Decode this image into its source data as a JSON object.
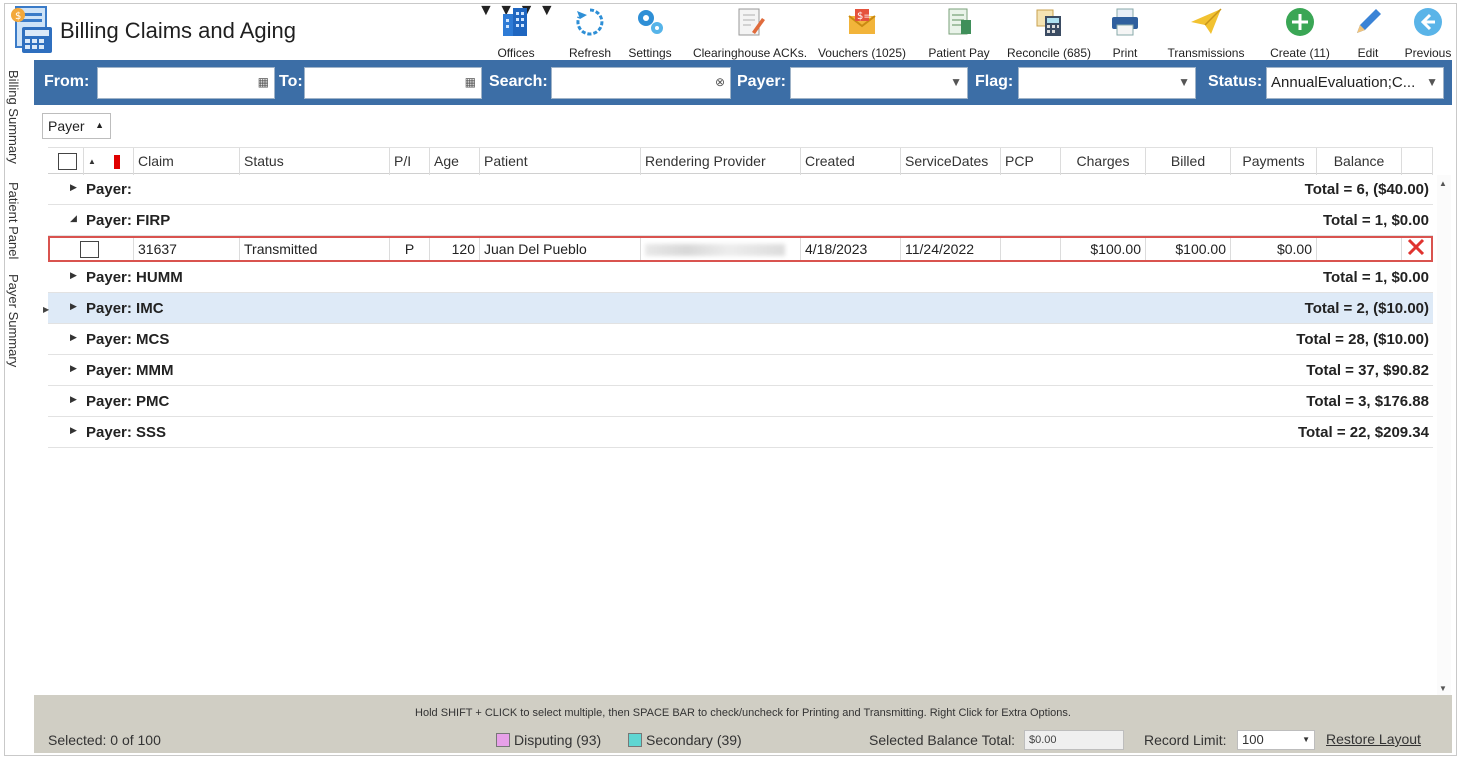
{
  "app": {
    "title": "Billing Claims and Aging"
  },
  "toolbar": {
    "offices": "Offices",
    "refresh": "Refresh",
    "settings": "Settings",
    "clearinghouse": "Clearinghouse ACKs.",
    "vouchers": "Vouchers (1025)",
    "patient_pay": "Patient Pay",
    "reconcile": "Reconcile (685)",
    "print": "Print",
    "transmissions": "Transmissions",
    "create": "Create (11)",
    "edit": "Edit",
    "previous": "Previous"
  },
  "filters": {
    "from_label": "From:",
    "to_label": "To:",
    "search_label": "Search:",
    "payer_label": "Payer:",
    "flag_label": "Flag:",
    "status_label": "Status:",
    "status_value": "AnnualEvaluation;C..."
  },
  "side_tabs": [
    "Billing Summary",
    "Patient Panel",
    "Payer Summary"
  ],
  "group_by": "Payer",
  "columns": [
    "Claim",
    "Status",
    "P/I",
    "Age",
    "Patient",
    "Rendering Provider",
    "Created",
    "ServiceDates",
    "PCP",
    "Charges",
    "Billed",
    "Payments",
    "Balance"
  ],
  "groups": [
    {
      "label": "Payer:",
      "total": "Total = 6,  ($40.00)"
    },
    {
      "label": "Payer: FIRP",
      "total": "Total = 1,  $0.00"
    },
    {
      "label": "Payer: HUMM",
      "total": "Total = 1,  $0.00"
    },
    {
      "label": "Payer: IMC",
      "total": "Total = 2,  ($10.00)"
    },
    {
      "label": "Payer: MCS",
      "total": "Total = 28,  ($10.00)"
    },
    {
      "label": "Payer: MMM",
      "total": "Total = 37,  $90.82"
    },
    {
      "label": "Payer: PMC",
      "total": "Total = 3,  $176.88"
    },
    {
      "label": "Payer: SSS",
      "total": "Total = 22,  $209.34"
    }
  ],
  "claim_row": {
    "claim": "31637",
    "status": "Transmitted",
    "pi": "P",
    "age": "120",
    "patient": "Juan Del Pueblo",
    "created": "4/18/2023",
    "service_dates": "11/24/2022",
    "pcp": "",
    "charges": "$100.00",
    "billed": "$100.00",
    "payments": "$0.00",
    "balance": ""
  },
  "footer": {
    "hint": "Hold SHIFT + CLICK to select multiple, then SPACE BAR to check/uncheck for Printing and Transmitting. Right Click for Extra Options.",
    "selected": "Selected: 0 of 100",
    "disputing": "Disputing (93)",
    "secondary": "Secondary (39)",
    "balance_label": "Selected Balance Total:",
    "balance_value": "$0.00",
    "record_label": "Record Limit:",
    "record_value": "100",
    "restore": "Restore Layout"
  },
  "colors": {
    "filter_bar": "#3c6ea6",
    "selected_group": "#deeaf7",
    "highlight_border": "#d9534f",
    "disputing": "#e7a0e8",
    "secondary": "#5fd6d2"
  }
}
